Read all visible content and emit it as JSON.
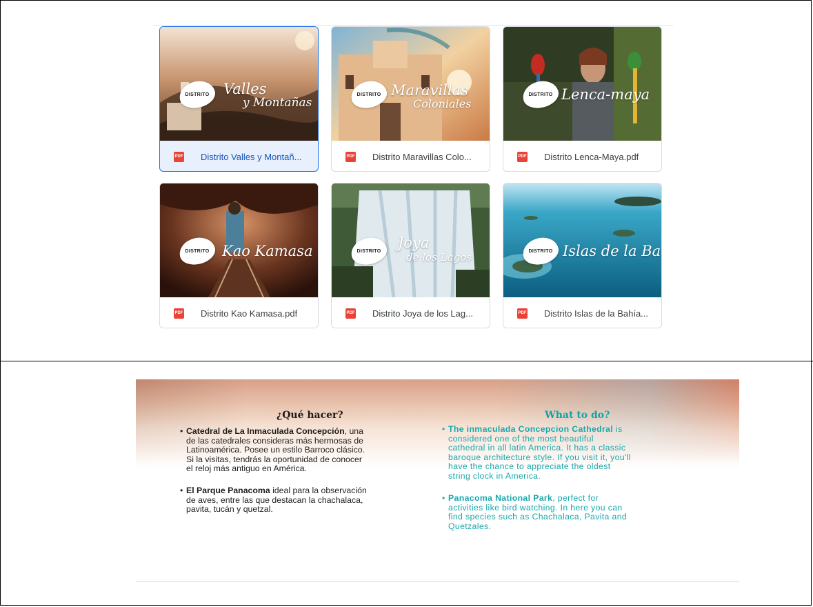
{
  "files": [
    {
      "name": "Distrito Valles y Montañ...",
      "badge": "DISTRITO",
      "script_lines": [
        "Valles",
        "y Montañas"
      ],
      "selected": true
    },
    {
      "name": "Distrito Maravillas Colo...",
      "badge": "DISTRITO",
      "script_lines": [
        "Maravillas",
        "Coloniales"
      ],
      "selected": false
    },
    {
      "name": "Distrito Lenca-Maya.pdf",
      "badge": "DISTRITO",
      "script_lines": [
        "Lenca-maya"
      ],
      "selected": false
    },
    {
      "name": "Distrito Kao Kamasa.pdf",
      "badge": "DISTRITO",
      "script_lines": [
        "Kao Kamasa"
      ],
      "selected": false
    },
    {
      "name": "Distrito Joya de los Lag...",
      "badge": "DISTRITO",
      "script_lines": [
        "Joya",
        "de los Lagos"
      ],
      "selected": false
    },
    {
      "name": "Distrito Islas de la Bahía...",
      "badge": "DISTRITO",
      "script_lines": [
        "Islas de la Bahía"
      ],
      "selected": false
    }
  ],
  "file_icon": {
    "label": "PDF",
    "icon": "pdf-icon",
    "color": "#ea4335"
  },
  "colors": {
    "selected_border": "#1a73e8",
    "selected_bg": "#e8f0fe",
    "english_text": "#18a7ab"
  },
  "banner": {
    "es": {
      "heading": "¿Qué hacer?",
      "items": [
        {
          "bold": "Catedral de La Inmaculada Concepción",
          "lines": [
            ", una",
            "de las catedrales consideras más hermosas de",
            "Latinoamérica. Posee un estilo Barroco clásico.",
            "Si la visitas, tendrás la oportunidad de conocer",
            "el reloj más antiguo en América."
          ]
        },
        {
          "bold": "El Parque Panacoma",
          "lines": [
            " ideal para la observación",
            "de aves, entre las que destacan la chachalaca,",
            "pavita, tucán y quetzal."
          ]
        }
      ]
    },
    "en": {
      "heading": "What to do?",
      "items": [
        {
          "bold": "The inmaculada Concepcion Cathedral",
          "lines": [
            " is",
            "considered one of the most beautiful",
            "cathedral in all latin America. It has a classic",
            "baroque architecture style. If you visit it, you'll",
            "have the chance to appreciate the oldest",
            "string clock in America."
          ]
        },
        {
          "bold": "Panacoma National Park",
          "lines": [
            ", perfect for",
            "activities like bird watching. In here you can",
            "find species such as Chachalaca, Pavita and",
            "Quetzales."
          ]
        }
      ]
    }
  }
}
